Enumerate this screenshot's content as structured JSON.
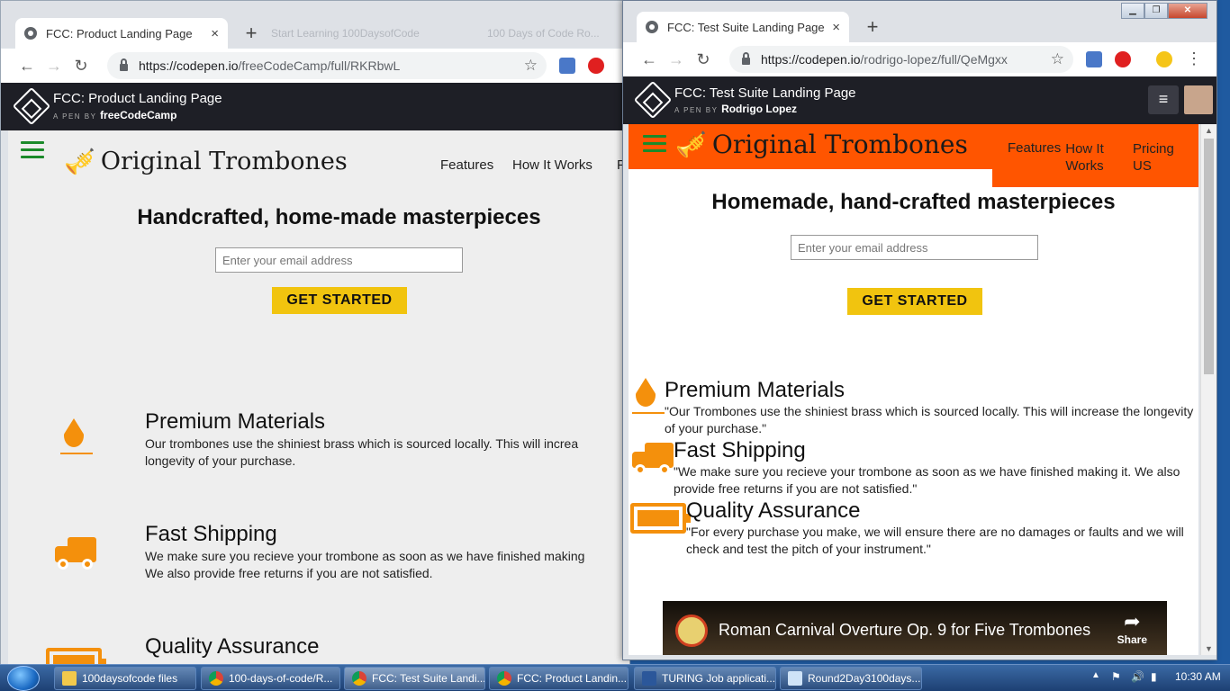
{
  "left_window": {
    "tab": {
      "title": "FCC: Product Landing Page",
      "close": "×"
    },
    "ghost_tabs": [
      "Start Learning 100DaysofCode",
      "100 Days of Code Ro..."
    ],
    "new_tab": "+",
    "url": {
      "base": "https://codepen.io",
      "path": "/freeCodeCamp/full/RKRbwL"
    },
    "codepen": {
      "title": "FCC: Product Landing Page",
      "by_prefix": "A PEN BY",
      "author": "freeCodeCamp"
    },
    "page": {
      "logo_text": "Original Trombones",
      "nav": [
        "Features",
        "How It Works",
        "P"
      ],
      "hero_title": "Handcrafted, home-made masterpieces",
      "email_placeholder": "Enter your email address",
      "cta": "GET STARTED",
      "features": [
        {
          "title": "Premium Materials",
          "text": "Our trombones use the shiniest brass which is sourced locally. This will increa",
          "text2": "longevity of your purchase."
        },
        {
          "title": "Fast Shipping",
          "text": "We make sure you recieve your trombone as soon as we have finished making",
          "text2": "We also provide free returns if you are not satisfied."
        },
        {
          "title": "Quality Assurance"
        }
      ]
    }
  },
  "right_window": {
    "tab": {
      "title": "FCC: Test Suite Landing Page",
      "close": "×"
    },
    "new_tab": "+",
    "url": {
      "base": "https://codepen.io",
      "path": "/rodrigo-lopez/full/QeMgxx"
    },
    "codepen": {
      "title": "FCC: Test Suite Landing Page",
      "by_prefix": "A PEN BY",
      "author": "Rodrigo Lopez"
    },
    "page": {
      "logo_text": "Original Trombones",
      "nav": [
        {
          "label": "Features"
        },
        {
          "label": "How It Works"
        },
        {
          "label": "Pricing US"
        }
      ],
      "hero_title": "Homemade, hand-crafted masterpieces",
      "email_placeholder": "Enter your email address",
      "cta": "GET STARTED",
      "features": [
        {
          "title": "Premium Materials",
          "text": "\"Our Trombones use the shiniest brass which is sourced locally. This will increase the longevity of your purchase.\""
        },
        {
          "title": "Fast Shipping",
          "text": "\"We make sure you recieve your trombone as soon as we have finished making it. We also provide free returns if you are not satisfied.\""
        },
        {
          "title": "Quality Assurance",
          "text": "\"For every purchase you make, we will ensure there are no damages or faults and we will check and test the pitch of your instrument.\""
        }
      ],
      "video": {
        "title": "Roman Carnival Overture Op. 9 for Five Trombones",
        "share": "Share"
      }
    }
  },
  "taskbar": {
    "items": [
      {
        "label": "100daysofcode files",
        "icon": "folder-icon"
      },
      {
        "label": "100-days-of-code/R...",
        "icon": "chrome-icon"
      },
      {
        "label": "FCC: Test Suite Landi...",
        "icon": "chrome-icon"
      },
      {
        "label": "FCC: Product Landin...",
        "icon": "chrome-icon"
      },
      {
        "label": "TURING Job applicati...",
        "icon": "word-icon"
      },
      {
        "label": "Round2Day3100days...",
        "icon": "notepad-icon"
      }
    ],
    "clock": "10:30 AM"
  },
  "colors": {
    "accent_orange": "#ff5500",
    "icon_orange": "#f4900c",
    "cta_yellow": "#f1c40f",
    "hamburger_green": "#1b8a2a",
    "codepen_bar": "#1e1f26"
  }
}
